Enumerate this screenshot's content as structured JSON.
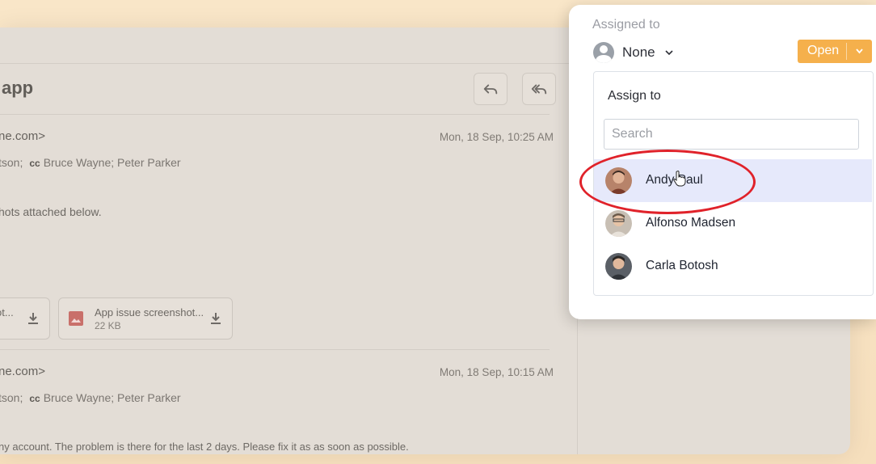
{
  "email": {
    "subject_fragment": "app",
    "messages": [
      {
        "from_fragment": "ne.com>",
        "date": "Mon, 18 Sep, 10:25 AM",
        "to_fragment": "tson;",
        "cc_label": "cc",
        "cc_list": "Bruce Wayne;  Peter Parker",
        "body_fragment": "hots attached below."
      },
      {
        "from_fragment": "ne.com>",
        "date": "Mon, 18 Sep, 10:15 AM",
        "to_fragment": "tson;",
        "cc_label": "cc",
        "cc_list": "Bruce Wayne;  Peter Parker",
        "body_fragment": "ny account. The problem is there for the last 2 days. Please fix it as as soon as possible."
      }
    ],
    "attachments": [
      {
        "name": "ot...",
        "size": ""
      },
      {
        "name": "App issue screenshot...",
        "size": "22 KB"
      }
    ]
  },
  "assign_panel": {
    "title": "Assigned to",
    "current_assignee": "None",
    "status_label": "Open",
    "dropdown_heading": "Assign to",
    "search_placeholder": "Search",
    "options": [
      {
        "name": "Andy Paul",
        "highlighted": true
      },
      {
        "name": "Alfonso Madsen",
        "highlighted": false
      },
      {
        "name": "Carla Botosh",
        "highlighted": false
      }
    ]
  },
  "colors": {
    "status_button": "#f5b04c",
    "highlight_row": "#e6e9fb",
    "annotation_circle": "#e0222a"
  }
}
